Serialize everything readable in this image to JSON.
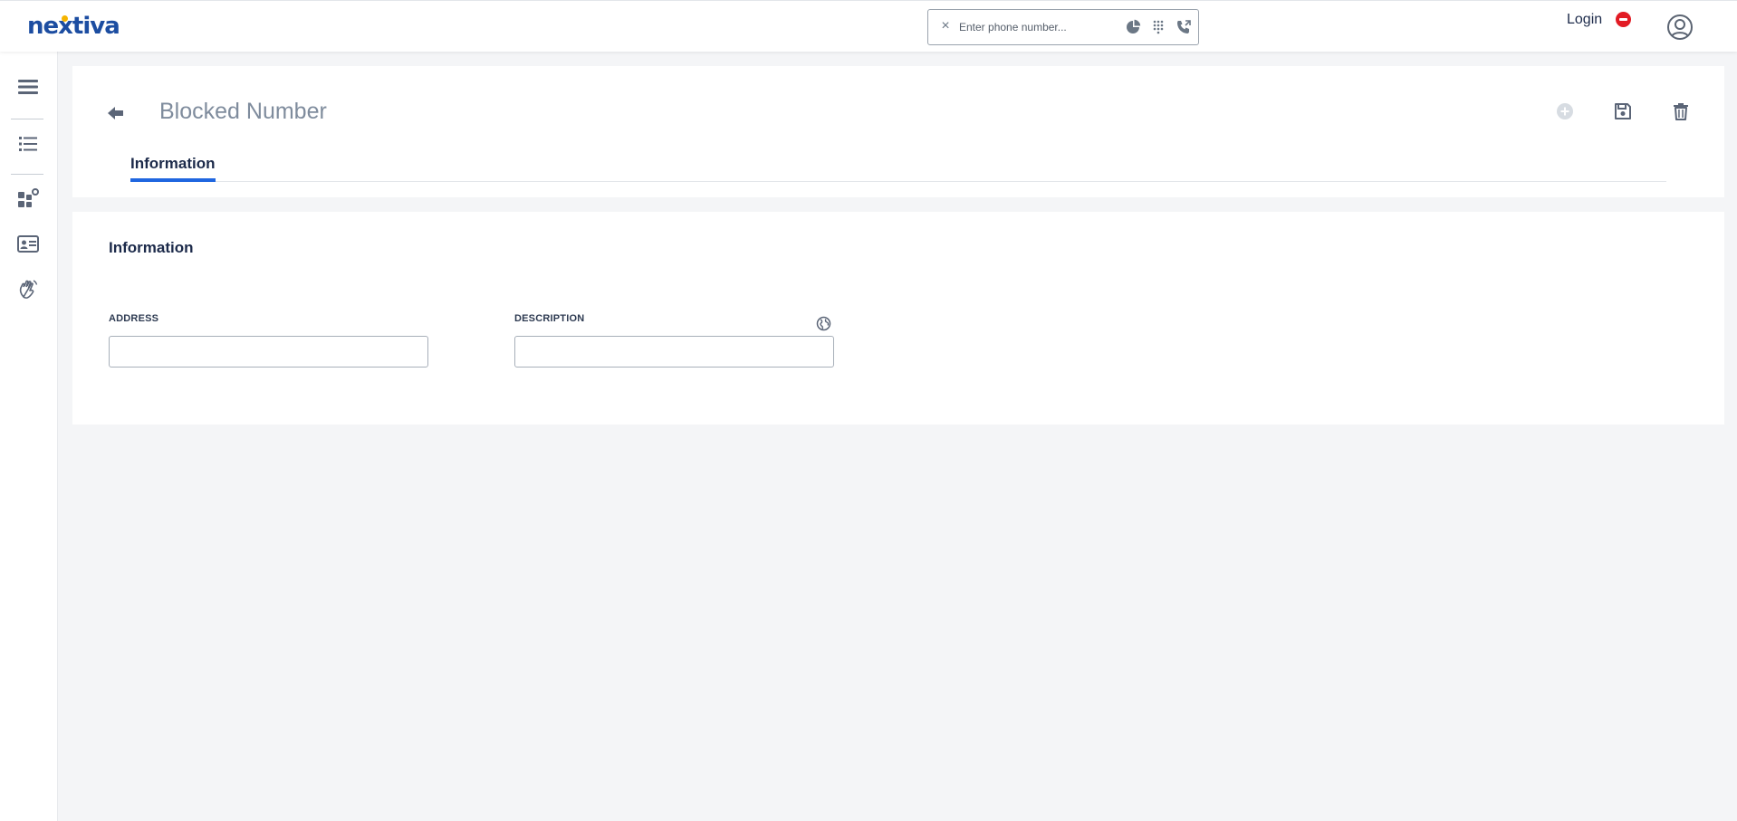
{
  "brand": {
    "logo_text": "nextiva",
    "logo_color": "#1c4da1",
    "dot_color": "#f5b400"
  },
  "dialer": {
    "placeholder": "Enter phone number...",
    "clear_glyph": "×",
    "icons": [
      "pie-chart-icon",
      "dialpad-icon",
      "phone-call-icon"
    ]
  },
  "user": {
    "login_label": "Login",
    "status_color": "#e21b24",
    "avatar_icon": "user-circle-icon"
  },
  "sidebar": {
    "items": [
      {
        "icon": "hamburger-menu-icon"
      },
      {
        "icon": "list-icon"
      },
      {
        "icon": "widgets-icon"
      },
      {
        "icon": "contact-card-icon"
      },
      {
        "icon": "hand-wave-icon"
      }
    ]
  },
  "header": {
    "title": "Blocked Number",
    "tabs": [
      {
        "label": "Information",
        "active": true
      }
    ],
    "actions": [
      "add-icon",
      "save-icon",
      "delete-icon"
    ]
  },
  "form": {
    "section_title": "Information",
    "fields": [
      {
        "label": "ADDRESS",
        "value": ""
      },
      {
        "label": "DESCRIPTION",
        "value": "",
        "icon": "globe-icon"
      }
    ]
  },
  "colors": {
    "accent": "#1f66e0",
    "text": "#1c2a4a",
    "muted": "#7f8c9d",
    "background": "#f4f5f7"
  }
}
